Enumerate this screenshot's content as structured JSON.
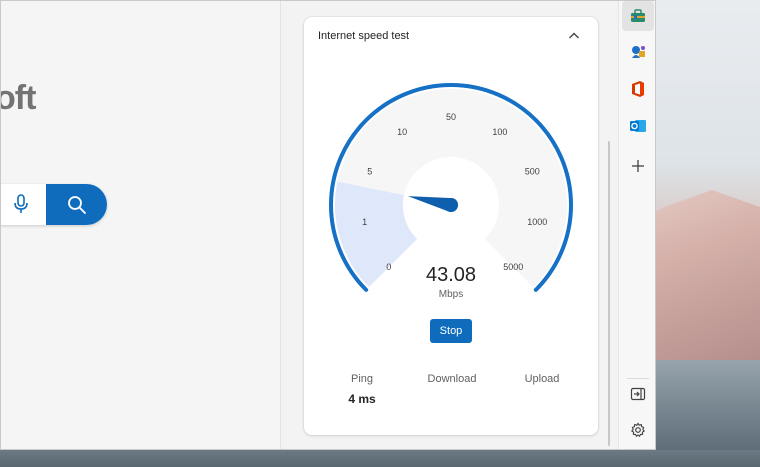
{
  "browser": {
    "brand_partial": "oft"
  },
  "widget": {
    "title": "Internet speed test",
    "gauge_ticks": [
      "0",
      "1",
      "5",
      "10",
      "50",
      "100",
      "500",
      "1000",
      "5000"
    ],
    "speed_value": "43.08",
    "speed_unit": "Mbps",
    "stop_label": "Stop",
    "metrics": [
      {
        "label": "Ping",
        "value": "4 ms"
      },
      {
        "label": "Download",
        "value": ""
      },
      {
        "label": "Upload",
        "value": ""
      }
    ],
    "progress_fraction": 0.21
  },
  "toolbar": {
    "icons": [
      "tools-icon",
      "games-icon",
      "office-icon",
      "outlook-icon",
      "add-icon",
      "hide-sidebar-icon",
      "settings-icon"
    ]
  },
  "colors": {
    "accent": "#0f6cbd",
    "gauge_arc": "#1570c6",
    "gauge_fill": "#dfe7fb",
    "gauge_bg": "#f6f6f6"
  }
}
